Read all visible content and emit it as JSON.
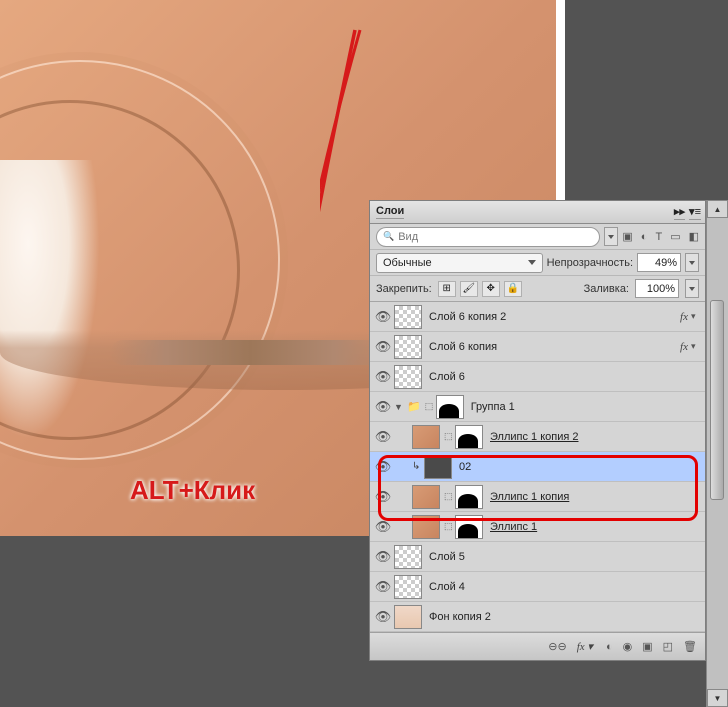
{
  "annotation": "ALT+Клик",
  "panel": {
    "title": "Слои",
    "search_placeholder": "Вид",
    "blend_mode": "Обычные",
    "opacity_label": "Непрозрачность:",
    "opacity_value": "49%",
    "lock_label": "Закрепить:",
    "fill_label": "Заливка:",
    "fill_value": "100%"
  },
  "layers": [
    {
      "name": "Слой 6 копия 2",
      "fx": true,
      "thumb": "checker"
    },
    {
      "name": "Слой 6 копия",
      "fx": true,
      "thumb": "checker"
    },
    {
      "name": "Слой 6",
      "thumb": "checker"
    },
    {
      "name": "Группа 1",
      "group": true
    },
    {
      "name": "Эллипс 1 копия 2",
      "thumb": "shape",
      "underline": true,
      "indent": 1
    },
    {
      "name": "02",
      "thumb": "dark",
      "selected": true,
      "indent": 1,
      "clip": true
    },
    {
      "name": "Эллипс 1 копия",
      "thumb": "shape",
      "underline": true,
      "indent": 1
    },
    {
      "name": "Эллипс 1",
      "thumb": "shape",
      "underline": true,
      "indent": 1
    },
    {
      "name": "Слой 5",
      "thumb": "checker"
    },
    {
      "name": "Слой 4",
      "thumb": "checker"
    },
    {
      "name": "Фон копия 2",
      "thumb": "photo"
    }
  ]
}
